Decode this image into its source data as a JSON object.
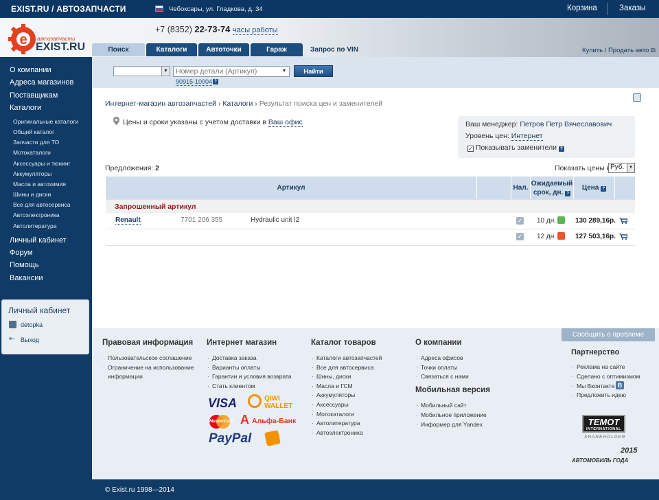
{
  "topbar": {
    "brand": "EXIST.RU / АВТОЗАПЧАСТИ",
    "city": "Чебоксары, ул. Гладкова, д. 34",
    "cart": "Корзина",
    "orders": "Заказы"
  },
  "header": {
    "phone_prefix": "+7 (8352)",
    "phone_number": "22-73-74",
    "hours": "часы работы",
    "logo_small": "автозапчасти",
    "logo_main": "EXIST.RU",
    "sell_buy": "Купить / Продать авто"
  },
  "tabs": [
    "Поиск",
    "Каталоги",
    "Автоточки",
    "Гараж",
    "Запрос по VIN"
  ],
  "sidebar": {
    "top": [
      "О компании",
      "Адреса магазинов",
      "Поставщикам",
      "Каталоги"
    ],
    "catalogs": [
      "Оригинальные каталоги",
      "Общий каталог",
      "Запчасти для ТО",
      "Мотокаталоги",
      "Аксессуары и тюнинг",
      "Аккумуляторы",
      "Масла и автохимия",
      "Шины и диски",
      "Все для автосервиса",
      "Автоэлектроника",
      "Автолитература"
    ],
    "bottom": [
      "Личный кабинет",
      "Форум",
      "Помощь",
      "Вакансии"
    ],
    "cabinet": {
      "title": "Личный кабинет",
      "user": "detopka",
      "logout": "Выход"
    }
  },
  "search": {
    "placeholder": "Номер детали (Артикул)",
    "button": "Найти",
    "example": "90915-10004",
    "q": "?"
  },
  "breadcrumb": {
    "home": "Интернет-магазин автозапчастей",
    "catalogs": "Каталоги",
    "current": "Результат поиска цен и заменителей",
    "sep": "›"
  },
  "delivery": {
    "text": "Цены и сроки указаны с учетом доставки в",
    "link": "Ваш офис"
  },
  "manager": {
    "label": "Ваш менеджер:",
    "name": "Петров Петр Вячеславович",
    "level_label": "Уровень цен:",
    "level": "Интернет",
    "show_repl": "Показывать заменители"
  },
  "offers": {
    "label": "Предложения:",
    "count": "2",
    "show_prices": "Показать цены в",
    "currency": "Руб."
  },
  "table": {
    "headers": {
      "article": "Артикул",
      "avail": "Нал.",
      "term": "Ожидаемый срок, дн.",
      "price": "Цена"
    },
    "section": "Запрошенный артикул",
    "brand": "Renault",
    "number": "7701 206 355",
    "desc": "Hydraulic unit l2",
    "rows": [
      {
        "days": "10 дн.",
        "price": "130 289,16р.",
        "color": "#5ab552"
      },
      {
        "days": "12 дн.",
        "price": "127 503,16р.",
        "color": "#e0582b"
      }
    ]
  },
  "footer": {
    "legal": {
      "title": "Правовая информация",
      "items": [
        "Пользовательское соглашение",
        "Ограничение на использование",
        "информации"
      ]
    },
    "shop": {
      "title": "Интернет магазин",
      "items": [
        "Доставка заказа",
        "Варианты оплаты",
        "Гарантии и условия возврата",
        "Стать клиентом"
      ]
    },
    "catalog": {
      "title": "Каталог товаров",
      "items": [
        "Каталоги автозапчастей",
        "Все для автосервиса",
        "Шины, диски",
        "Масла и ГСМ",
        "Аккумуляторы",
        "Аксессуары",
        "Мотокаталоги",
        "Автолитература",
        "Автоэлектроника"
      ]
    },
    "about": {
      "title": "О компании",
      "items": [
        "Адреса офисов",
        "Точки оплаты",
        "Связаться с нами"
      ]
    },
    "mobile": {
      "title": "Мобильная версия",
      "items": [
        "Мобильный сайт",
        "Мобильное приложение",
        "Информер для Yandex"
      ]
    },
    "partner": {
      "title": "Партнерство",
      "items": [
        "Реклама на сайте",
        "Сделано с оптимизмом",
        "Мы Вконтакте",
        "Предложить идею"
      ]
    },
    "problem": "Сообщить о проблеме",
    "pay": {
      "visa": "VISA",
      "qiwi1": "QIWI",
      "qiwi2": "WALLET",
      "mc": "MasterCard",
      "alfa": "Альфа-Банк",
      "paypal": "PayPal"
    },
    "temot1": "TEMOT",
    "temot2": "INTERNATIONAL",
    "temot3": "SHAREHOLDER",
    "award_year": "2015",
    "award": "АВТОМОБИЛЬ ГОДА",
    "vk": "B",
    "copyright": "© Exist.ru 1998—2014"
  }
}
